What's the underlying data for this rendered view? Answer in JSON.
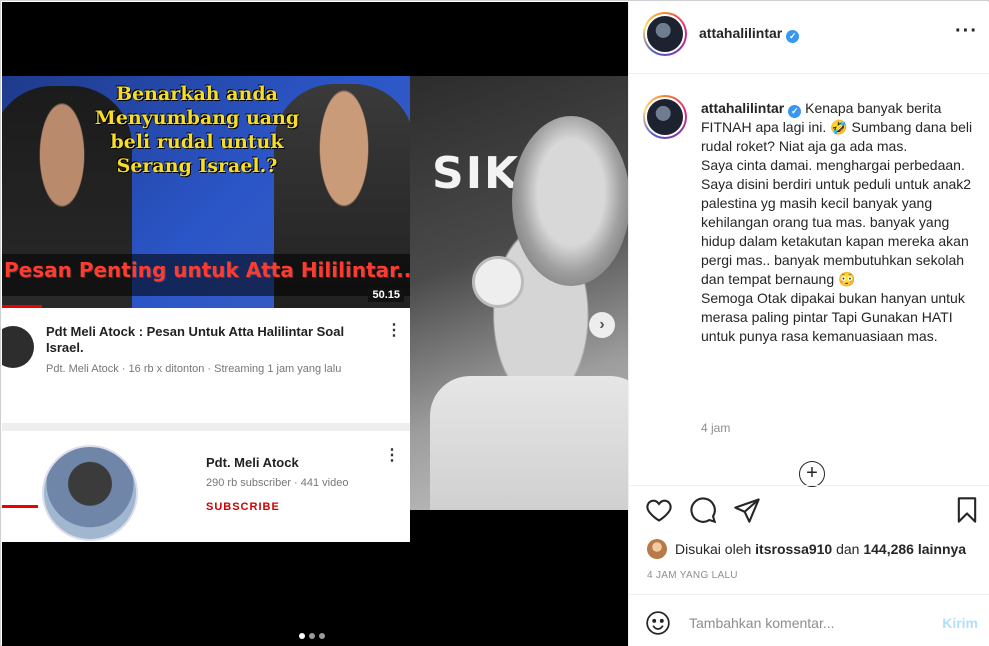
{
  "media": {
    "thumbnail_headline": "Benarkah anda Menyumbang uang beli rudal untuk Serang Israel.?",
    "thumbnail_banner": "Pesan Penting untuk Atta Hililintar..!!!",
    "video_duration": "50.15",
    "yt_video_title": "Pdt Meli Atock : Pesan Untuk Atta Halilintar Soal Israel.",
    "yt_video_meta": "Pdt. Meli Atock · 16 rb x ditonton · Streaming 1 jam yang lalu",
    "yt_channel_name": "Pdt. Meli Atock",
    "yt_channel_meta": "290 rb subscriber · 441 video",
    "yt_subscribe": "SUBSCRIBE",
    "photo_text": "SIK S",
    "carousel_total": 3,
    "carousel_active": 1
  },
  "post": {
    "username": "attahalilintar",
    "verified": true,
    "caption_lines": [
      "Kenapa banyak berita FITNAH apa lagi ini. 🤣 Sumbang dana beli rudal roket? Niat aja ga ada mas.",
      "Saya cinta damai. menghargai perbedaan.",
      "Saya disini berdiri untuk peduli untuk anak2 palestina yg masih kecil banyak yang kehilangan orang tua mas. banyak yang hidup dalam ketakutan kapan mereka akan pergi mas.. banyak membutuhkan sekolah dan tempat bernaung 😳",
      "Semoga Otak dipakai bukan hanyan untuk merasa paling pintar Tapi Gunakan HATI untuk punya rasa kemanuasiaan mas."
    ],
    "caption_time": "4 jam",
    "likes_prefix": "Disukai oleh",
    "liked_by": "itsrossa910",
    "likes_mid": "dan",
    "likes_count": "144,286 lainnya",
    "posted_ago": "4 JAM YANG LALU",
    "comment_placeholder": "Tambahkan komentar...",
    "post_button": "Kirim"
  },
  "icons": {
    "more": "more-options-icon",
    "like": "heart-icon",
    "comment": "comment-bubble-icon",
    "share": "paper-plane-icon",
    "save": "bookmark-icon",
    "emoji": "emoji-icon",
    "load_more": "plus-circle-icon",
    "next": "chevron-right-icon"
  },
  "colors": {
    "verified": "#3897f0",
    "post_button_disabled": "#b2dffc",
    "muted_text": "#8e8e8e"
  }
}
